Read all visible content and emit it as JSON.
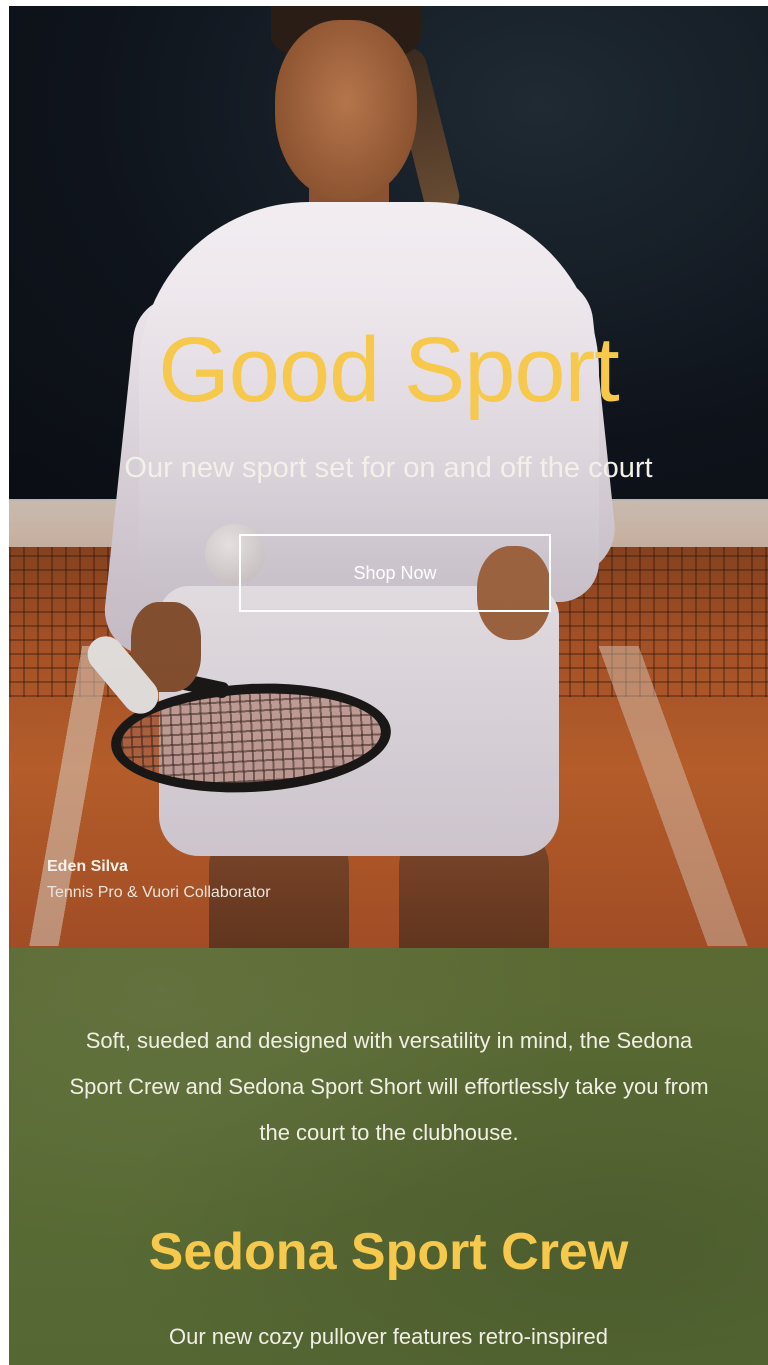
{
  "hero": {
    "title": "Good Sport",
    "subtitle": "Our new sport set for on and off the court",
    "cta_label": "Shop Now",
    "credit_name": "Eden Silva",
    "credit_role": "Tennis Pro & Vuori Collaborator"
  },
  "intro": {
    "body": "Soft, sueded and designed with versatility in mind, the Sedona Sport Crew and Sedona Sport Short will effortlessly take you from the court to the clubhouse."
  },
  "product": {
    "title": "Sedona Sport Crew",
    "description": "Our new cozy pullover features retro-inspired"
  },
  "colors": {
    "accent_yellow": "#f6c84c",
    "section_green": "#5a6b35",
    "text_light": "#f1eee4"
  }
}
